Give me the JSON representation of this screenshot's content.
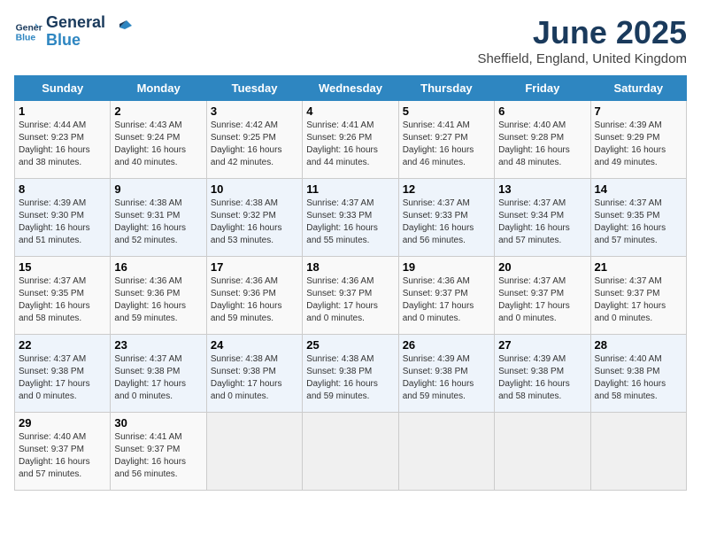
{
  "logo": {
    "line1": "General",
    "line2": "Blue"
  },
  "title": "June 2025",
  "location": "Sheffield, England, United Kingdom",
  "days_of_week": [
    "Sunday",
    "Monday",
    "Tuesday",
    "Wednesday",
    "Thursday",
    "Friday",
    "Saturday"
  ],
  "weeks": [
    [
      {
        "day": "1",
        "sunrise": "4:44 AM",
        "sunset": "9:23 PM",
        "daylight": "16 hours and 38 minutes."
      },
      {
        "day": "2",
        "sunrise": "4:43 AM",
        "sunset": "9:24 PM",
        "daylight": "16 hours and 40 minutes."
      },
      {
        "day": "3",
        "sunrise": "4:42 AM",
        "sunset": "9:25 PM",
        "daylight": "16 hours and 42 minutes."
      },
      {
        "day": "4",
        "sunrise": "4:41 AM",
        "sunset": "9:26 PM",
        "daylight": "16 hours and 44 minutes."
      },
      {
        "day": "5",
        "sunrise": "4:41 AM",
        "sunset": "9:27 PM",
        "daylight": "16 hours and 46 minutes."
      },
      {
        "day": "6",
        "sunrise": "4:40 AM",
        "sunset": "9:28 PM",
        "daylight": "16 hours and 48 minutes."
      },
      {
        "day": "7",
        "sunrise": "4:39 AM",
        "sunset": "9:29 PM",
        "daylight": "16 hours and 49 minutes."
      }
    ],
    [
      {
        "day": "8",
        "sunrise": "4:39 AM",
        "sunset": "9:30 PM",
        "daylight": "16 hours and 51 minutes."
      },
      {
        "day": "9",
        "sunrise": "4:38 AM",
        "sunset": "9:31 PM",
        "daylight": "16 hours and 52 minutes."
      },
      {
        "day": "10",
        "sunrise": "4:38 AM",
        "sunset": "9:32 PM",
        "daylight": "16 hours and 53 minutes."
      },
      {
        "day": "11",
        "sunrise": "4:37 AM",
        "sunset": "9:33 PM",
        "daylight": "16 hours and 55 minutes."
      },
      {
        "day": "12",
        "sunrise": "4:37 AM",
        "sunset": "9:33 PM",
        "daylight": "16 hours and 56 minutes."
      },
      {
        "day": "13",
        "sunrise": "4:37 AM",
        "sunset": "9:34 PM",
        "daylight": "16 hours and 57 minutes."
      },
      {
        "day": "14",
        "sunrise": "4:37 AM",
        "sunset": "9:35 PM",
        "daylight": "16 hours and 57 minutes."
      }
    ],
    [
      {
        "day": "15",
        "sunrise": "4:37 AM",
        "sunset": "9:35 PM",
        "daylight": "16 hours and 58 minutes."
      },
      {
        "day": "16",
        "sunrise": "4:36 AM",
        "sunset": "9:36 PM",
        "daylight": "16 hours and 59 minutes."
      },
      {
        "day": "17",
        "sunrise": "4:36 AM",
        "sunset": "9:36 PM",
        "daylight": "16 hours and 59 minutes."
      },
      {
        "day": "18",
        "sunrise": "4:36 AM",
        "sunset": "9:37 PM",
        "daylight": "17 hours and 0 minutes."
      },
      {
        "day": "19",
        "sunrise": "4:36 AM",
        "sunset": "9:37 PM",
        "daylight": "17 hours and 0 minutes."
      },
      {
        "day": "20",
        "sunrise": "4:37 AM",
        "sunset": "9:37 PM",
        "daylight": "17 hours and 0 minutes."
      },
      {
        "day": "21",
        "sunrise": "4:37 AM",
        "sunset": "9:37 PM",
        "daylight": "17 hours and 0 minutes."
      }
    ],
    [
      {
        "day": "22",
        "sunrise": "4:37 AM",
        "sunset": "9:38 PM",
        "daylight": "17 hours and 0 minutes."
      },
      {
        "day": "23",
        "sunrise": "4:37 AM",
        "sunset": "9:38 PM",
        "daylight": "17 hours and 0 minutes."
      },
      {
        "day": "24",
        "sunrise": "4:38 AM",
        "sunset": "9:38 PM",
        "daylight": "17 hours and 0 minutes."
      },
      {
        "day": "25",
        "sunrise": "4:38 AM",
        "sunset": "9:38 PM",
        "daylight": "16 hours and 59 minutes."
      },
      {
        "day": "26",
        "sunrise": "4:39 AM",
        "sunset": "9:38 PM",
        "daylight": "16 hours and 59 minutes."
      },
      {
        "day": "27",
        "sunrise": "4:39 AM",
        "sunset": "9:38 PM",
        "daylight": "16 hours and 58 minutes."
      },
      {
        "day": "28",
        "sunrise": "4:40 AM",
        "sunset": "9:38 PM",
        "daylight": "16 hours and 58 minutes."
      }
    ],
    [
      {
        "day": "29",
        "sunrise": "4:40 AM",
        "sunset": "9:37 PM",
        "daylight": "16 hours and 57 minutes."
      },
      {
        "day": "30",
        "sunrise": "4:41 AM",
        "sunset": "9:37 PM",
        "daylight": "16 hours and 56 minutes."
      },
      null,
      null,
      null,
      null,
      null
    ]
  ]
}
